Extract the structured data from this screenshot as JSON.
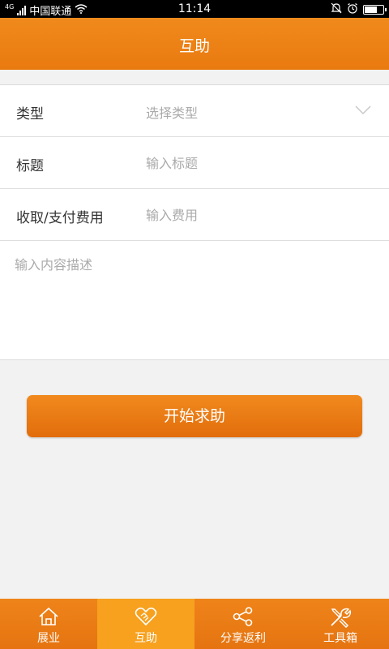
{
  "status_bar": {
    "network": "4G",
    "carrier": "中国联通",
    "time": "11:14",
    "icons": [
      "signal-icon",
      "wifi-icon",
      "mute-icon",
      "alarm-icon",
      "battery-icon"
    ],
    "battery_level": 0.75
  },
  "header": {
    "title": "互助"
  },
  "form": {
    "type": {
      "label": "类型",
      "placeholder": "选择类型",
      "icon": "chevron-down-icon"
    },
    "title": {
      "label": "标题",
      "placeholder": "输入标题"
    },
    "fee": {
      "label": "收取/支付费用",
      "placeholder": "输入费用"
    },
    "description": {
      "placeholder": "输入内容描述"
    }
  },
  "submit": {
    "label": "开始求助"
  },
  "tabbar": {
    "active": 1,
    "colors": {
      "bar": "#e97a10",
      "active": "#f7a11e"
    },
    "items": [
      {
        "label": "展业",
        "icon": "home-icon"
      },
      {
        "label": "互助",
        "icon": "handshake-heart-icon"
      },
      {
        "label": "分享返利",
        "icon": "share-icon"
      },
      {
        "label": "工具箱",
        "icon": "tools-icon"
      }
    ]
  }
}
